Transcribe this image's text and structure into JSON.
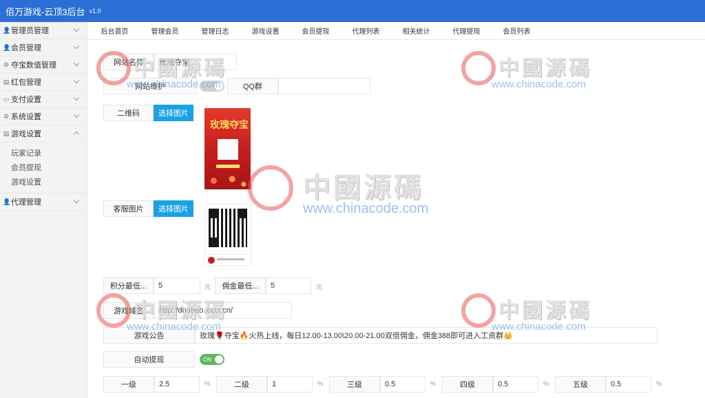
{
  "header": {
    "title": "佰万游戏-云顶3后台",
    "version": "v1.0"
  },
  "sidebar": {
    "items": [
      {
        "label": "管理员管理",
        "icon": "user-icon"
      },
      {
        "label": "会员管理",
        "icon": "user-icon"
      },
      {
        "label": "夺宝数值管理",
        "icon": "settings-icon"
      },
      {
        "label": "红包管理",
        "icon": "list-icon"
      },
      {
        "label": "支付设置",
        "icon": "card-icon"
      },
      {
        "label": "系统设置",
        "icon": "gear-icon"
      },
      {
        "label": "游戏设置",
        "icon": "list-icon"
      },
      {
        "label": "代理管理",
        "icon": "user-icon"
      }
    ],
    "sub_items": [
      "玩家记录",
      "会员提现",
      "游戏设置"
    ]
  },
  "tabs": [
    "后台首页",
    "管理会员",
    "管理日志",
    "游戏设置",
    "会员提现",
    "代理列表",
    "相关统计",
    "代理提现",
    "会员列表"
  ],
  "form": {
    "site_name": {
      "label": "网站名称",
      "value": "玫瑰夺宝"
    },
    "site_maintain": {
      "label": "网站维护"
    },
    "qq_group": {
      "label": "QQ群",
      "value": ""
    },
    "qrcode": {
      "label": "二维码",
      "button": "选择图片"
    },
    "service_image": {
      "label": "客服图片",
      "button": "选择图片"
    },
    "poster_text": "玫瑰夺宝",
    "points_min": {
      "label": "积分最低...",
      "value": "5",
      "unit": "元"
    },
    "commission_min": {
      "label": "佣金最低...",
      "value": "5",
      "unit": "元"
    },
    "game_domain": {
      "label": "游戏域名",
      "value": "http://duobao.xxxx.cn/"
    },
    "announcement": {
      "label": "游戏公告",
      "value": "玫瑰🌹夺宝🔥火热上线，每日12.00-13.00\\20.00-21.00双倍佣金，佣金388即可进入工资群👑"
    },
    "auto_withdraw": {
      "label": "自动提现",
      "toggle": "ON"
    },
    "levels": [
      {
        "label": "一级",
        "value": "2.5",
        "unit": "%"
      },
      {
        "label": "二级",
        "value": "1",
        "unit": "%"
      },
      {
        "label": "三级",
        "value": "0.5",
        "unit": "%"
      },
      {
        "label": "四级",
        "value": "0.5",
        "unit": "%"
      },
      {
        "label": "五级",
        "value": "0.5",
        "unit": "%"
      }
    ]
  },
  "watermark": {
    "text": "中國源碼",
    "url": "www.chinacode.com"
  }
}
